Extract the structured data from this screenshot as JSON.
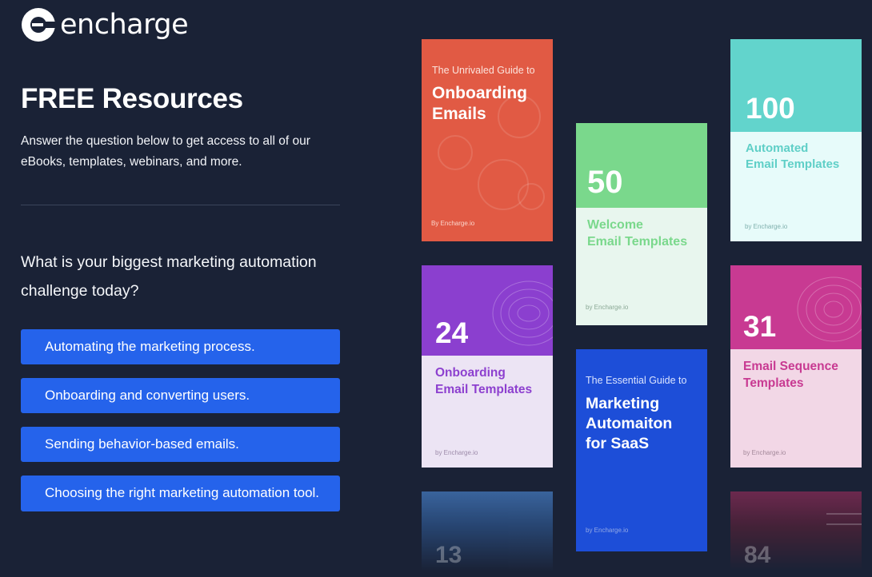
{
  "brand": {
    "logo_text": "encharge"
  },
  "hero": {
    "title": "FREE Resources",
    "intro": "Answer the question below to get access to all of our eBooks, templates, webinars, and more."
  },
  "quiz": {
    "question": "What is your biggest marketing automation challenge today?",
    "answers": [
      "Automating the marketing process.",
      "Onboarding and converting users.",
      "Sending behavior-based emails.",
      "Choosing the right marketing automation tool."
    ]
  },
  "resources": {
    "onboarding_guide": {
      "pre": "The Unrivaled Guide to",
      "title_line1": "Onboarding",
      "title_line2": "Emails",
      "by": "By Encharge.io"
    },
    "welcome_templates": {
      "number": "50",
      "line1": "Welcome",
      "line2": "Email Templates",
      "by": "by Encharge.io"
    },
    "automated_templates": {
      "number": "100",
      "line1": "Automated",
      "line2": "Email Templates",
      "by": "by Encharge.io"
    },
    "onboarding_templates": {
      "number": "24",
      "line1": "Onboarding",
      "line2": "Email Templates",
      "by": "by Encharge.io"
    },
    "marketing_guide": {
      "pre": "The Essential Guide to",
      "title_line1": "Marketing",
      "title_line2": "Automaiton",
      "title_line3": "for SaaS",
      "by": "by Encharge.io"
    },
    "sequence_templates": {
      "number": "31",
      "line1": "Email Sequence",
      "line2": "Templates",
      "by": "by Encharge.io"
    },
    "partial_left": {
      "number": "13"
    },
    "partial_right": {
      "number": "84"
    }
  },
  "colors": {
    "background": "#1a2236",
    "button": "#2563eb",
    "red": "#e15a44",
    "green": "#7ad88c",
    "teal": "#62d4cc",
    "purple": "#8b3fcf",
    "blue": "#1d4ed8",
    "pink": "#c83a92"
  }
}
